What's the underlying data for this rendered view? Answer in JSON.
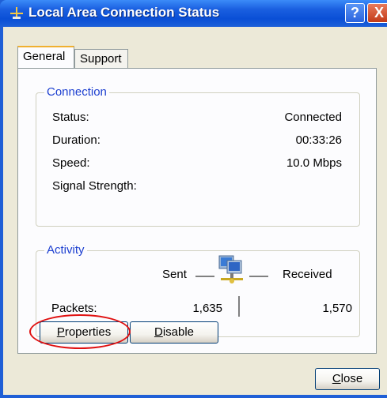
{
  "window": {
    "title": "Local Area Connection Status",
    "help_label": "?",
    "close_label": "X"
  },
  "tabs": [
    {
      "label": "General",
      "active": true
    },
    {
      "label": "Support",
      "active": false
    }
  ],
  "connection": {
    "legend": "Connection",
    "rows": [
      {
        "label": "Status:",
        "value": "Connected"
      },
      {
        "label": "Duration:",
        "value": "00:33:26"
      },
      {
        "label": "Speed:",
        "value": "10.0 Mbps"
      },
      {
        "label": "Signal Strength:",
        "value": ""
      }
    ]
  },
  "activity": {
    "legend": "Activity",
    "sent_label": "Sent",
    "received_label": "Received",
    "packets_label": "Packets:",
    "packets_sent": "1,635",
    "packets_received": "1,570"
  },
  "buttons": {
    "properties": {
      "accel": "P",
      "rest": "roperties"
    },
    "disable": {
      "accel": "D",
      "rest": "isable"
    },
    "close": {
      "accel": "C",
      "rest": "lose"
    }
  },
  "colors": {
    "titlebar": "#0a4fd6",
    "group_legend": "#1c3fd0",
    "highlight": "#e01010"
  }
}
